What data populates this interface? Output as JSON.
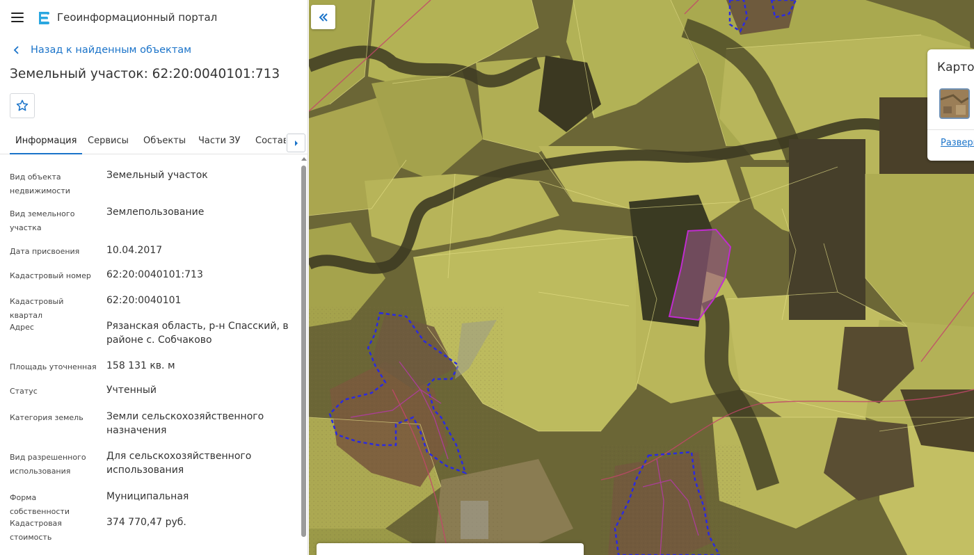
{
  "header": {
    "app_title": "Геоинформационный портал",
    "menu_icon": "hamburger-menu-icon",
    "logo_icon": "portal-logo-icon"
  },
  "back_link": {
    "label": "Назад к найденным объектам",
    "icon": "chevron-left-icon"
  },
  "object": {
    "title": "Земельный участок: 62:20:0040101:713"
  },
  "favorite": {
    "icon": "star-outline-icon"
  },
  "tabs": [
    {
      "label": "Информация",
      "active": true
    },
    {
      "label": "Сервисы",
      "active": false
    },
    {
      "label": "Объекты",
      "active": false
    },
    {
      "label": "Части ЗУ",
      "active": false
    },
    {
      "label": "Состав",
      "active": false
    }
  ],
  "tabs_next_icon": "triangle-right-icon",
  "info": [
    {
      "label": "Вид объекта недвижимости",
      "value": "Земельный участок"
    },
    {
      "label": "Вид земельного участка",
      "value": "Землепользование"
    },
    {
      "label": "Дата присвоения",
      "value": "10.04.2017"
    },
    {
      "label": "Кадастровый номер",
      "value": "62:20:0040101:713"
    },
    {
      "label": "Кадастровый квартал",
      "value": "62:20:0040101"
    },
    {
      "label": "Адрес",
      "value": "Рязанская область, р-н Спасский, в районе с. Собчаково"
    },
    {
      "label": "Площадь уточненная",
      "value": "158 131 кв. м"
    },
    {
      "label": "Статус",
      "value": "Учтенный"
    },
    {
      "label": "Категория земель",
      "value": "Земли сельскохозяйственного назначения"
    },
    {
      "label": "Вид разрешенного использования",
      "value": "Для сельскохозяйственного использования"
    },
    {
      "label": "Форма собственности",
      "value": "Муниципальная"
    },
    {
      "label": "Кадастровая стоимость",
      "value": "374 770,47 руб."
    }
  ],
  "map": {
    "collapse_icon": "double-chevron-left-icon",
    "basemap": {
      "title": "Карто",
      "link": "Разверн"
    }
  },
  "colors": {
    "accent": "#1a73c9",
    "parcel_overlay": "#d6d15a",
    "selected_parcel": "#c02ccf",
    "settlement_border": "#2a2ae0"
  }
}
